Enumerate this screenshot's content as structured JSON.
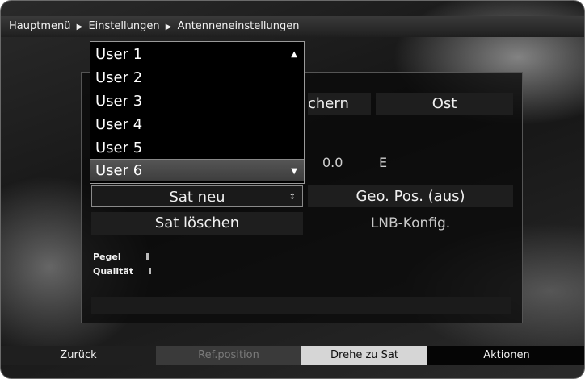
{
  "breadcrumb": {
    "items": [
      "Hauptmenü",
      "Einstellungen",
      "Antenneneinstellungen"
    ]
  },
  "dropdown": {
    "items": [
      "User 1",
      "User 2",
      "User 3",
      "User 4",
      "User 5",
      "User 6"
    ],
    "selected_index": 5
  },
  "panel": {
    "save_partial": "chern",
    "direction": "Ost",
    "position_value": "0.0",
    "position_dir": "E",
    "sat_new": "Sat neu",
    "geo_pos": "Geo. Pos. (aus)",
    "sat_delete": "Sat löschen",
    "lnb_config": "LNB-Konfig.",
    "level_label": "Pegel",
    "quality_label": "Qualität"
  },
  "footer": {
    "back": "Zurück",
    "ref_position": "Ref.position",
    "turn_to_sat": "Drehe zu Sat",
    "actions": "Aktionen"
  },
  "colors": {
    "footer_green": "#3a3a3a",
    "footer_yellow": "#d6d6d6",
    "footer_blue": "#050505",
    "footer_red": "#1f1f1f"
  }
}
